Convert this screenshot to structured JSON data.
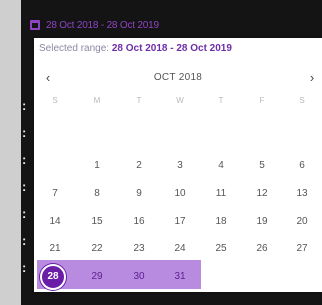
{
  "header": {
    "range": "28 Oct 2018 - 28 Oct 2019",
    "icon": "calendar-icon"
  },
  "bullets": [
    ":",
    ":",
    ":",
    ":",
    ":",
    ":",
    ":"
  ],
  "popup": {
    "selected_label": "Selected range:",
    "selected_value": "28 Oct 2018 - 28 Oct 2019",
    "month": "OCT 2018",
    "prev": "‹",
    "next": "›",
    "weekdays": [
      "S",
      "M",
      "T",
      "W",
      "T",
      "F",
      "S"
    ],
    "weeks": [
      [
        "",
        "1",
        "2",
        "3",
        "4",
        "5",
        "6"
      ],
      [
        "7",
        "8",
        "9",
        "10",
        "11",
        "12",
        "13"
      ],
      [
        "14",
        "15",
        "16",
        "17",
        "18",
        "19",
        "20"
      ],
      [
        "21",
        "22",
        "23",
        "24",
        "25",
        "26",
        "27"
      ],
      [
        "28",
        "29",
        "30",
        "31",
        "",
        "",
        ""
      ]
    ],
    "selected_start": "28",
    "accent": "#6a1ea8",
    "highlight": "#b98be0"
  }
}
